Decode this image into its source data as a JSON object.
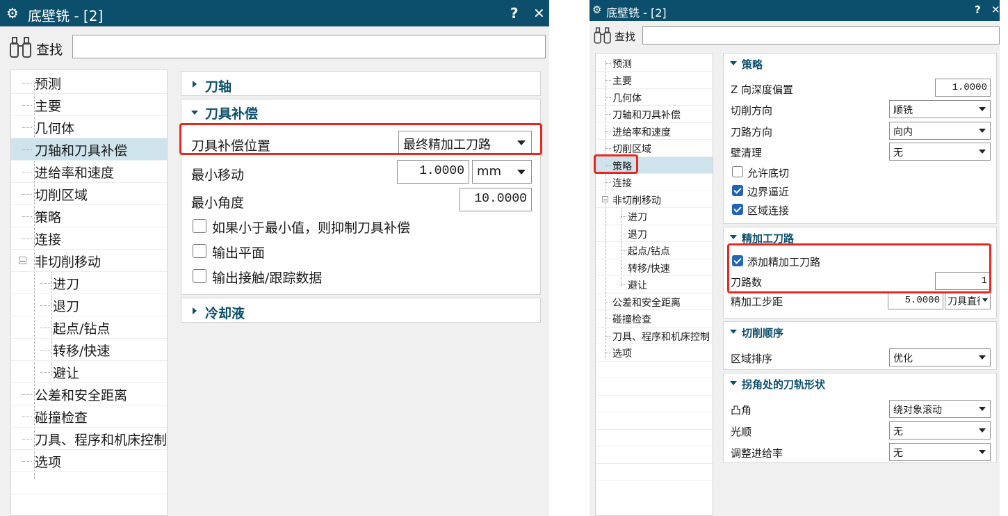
{
  "left": {
    "title": "底壁铣 - [2]",
    "help": "?",
    "close": "✕",
    "find_label": "查找",
    "find_value": "",
    "tree": [
      {
        "label": "预测"
      },
      {
        "label": "主要"
      },
      {
        "label": "几何体"
      },
      {
        "label": "刀轴和刀具补偿"
      },
      {
        "label": "进给率和速度"
      },
      {
        "label": "切削区域"
      },
      {
        "label": "策略"
      },
      {
        "label": "连接"
      },
      {
        "label": "非切削移动"
      },
      {
        "label": "进刀"
      },
      {
        "label": "退刀"
      },
      {
        "label": "起点/钻点"
      },
      {
        "label": "转移/快速"
      },
      {
        "label": "避让"
      },
      {
        "label": "公差和安全距离"
      },
      {
        "label": "碰撞检查"
      },
      {
        "label": "刀具、程序和机床控制"
      },
      {
        "label": "选项"
      }
    ],
    "groups": {
      "axis": "刀轴",
      "comp": "刀具补偿",
      "coolant": "冷却液"
    },
    "comp_position_label": "刀具补偿位置",
    "comp_position_value": "最终精加工刀路",
    "min_move_label": "最小移动",
    "min_move_value": "1.0000",
    "min_move_unit": "mm",
    "min_angle_label": "最小角度",
    "min_angle_value": "10.0000",
    "cb1": "如果小于最小值，则抑制刀具补偿",
    "cb2": "输出平面",
    "cb3": "输出接触/跟踪数据"
  },
  "right": {
    "title": "底壁铣 - [2]",
    "help": "?",
    "close": "✕",
    "find_label": "查找",
    "find_value": "",
    "tree": [
      {
        "label": "预测"
      },
      {
        "label": "主要"
      },
      {
        "label": "几何体"
      },
      {
        "label": "刀轴和刀具补偿"
      },
      {
        "label": "进给率和速度"
      },
      {
        "label": "切削区域"
      },
      {
        "label": "策略"
      },
      {
        "label": "连接"
      },
      {
        "label": "非切削移动"
      },
      {
        "label": "进刀"
      },
      {
        "label": "退刀"
      },
      {
        "label": "起点/钻点"
      },
      {
        "label": "转移/快速"
      },
      {
        "label": "避让"
      },
      {
        "label": "公差和安全距离"
      },
      {
        "label": "碰撞检查"
      },
      {
        "label": "刀具、程序和机床控制"
      },
      {
        "label": "选项"
      }
    ],
    "strategy": {
      "title": "策略",
      "z_offset_label": "Z 向深度偏置",
      "z_offset_value": "1.0000",
      "cut_dir_label": "切削方向",
      "cut_dir_value": "顺铣",
      "path_dir_label": "刀路方向",
      "path_dir_value": "向内",
      "wall_clean_label": "壁清理",
      "wall_clean_value": "无",
      "cb_undercut": "允许底切",
      "cb_boundary": "边界逼近",
      "cb_region": "区域连接"
    },
    "finish": {
      "title": "精加工刀路",
      "cb_add": "添加精加工刀路",
      "passes_label": "刀路数",
      "passes_value": "1",
      "step_label": "精加工步距",
      "step_value": "5.0000",
      "step_unit": "刀具直径"
    },
    "order": {
      "title": "切削顺序",
      "region_label": "区域排序",
      "region_value": "优化"
    },
    "corner": {
      "title": "拐角处的刀轨形状",
      "convex_label": "凸角",
      "convex_value": "绕对象滚动",
      "smooth_label": "光顺",
      "smooth_value": "无",
      "feed_label": "调整进给率",
      "feed_value": "无"
    }
  }
}
